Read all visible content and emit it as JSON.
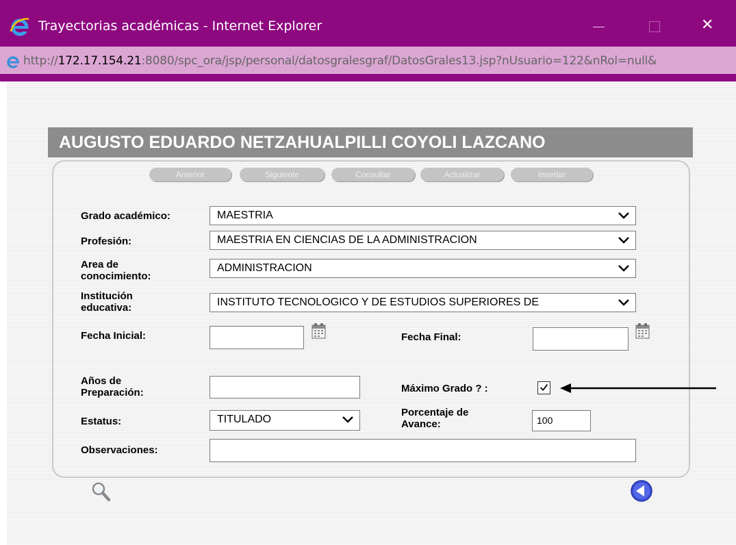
{
  "window": {
    "title": "Trayectorias académicas - Internet Explorer",
    "url_prefix": "http://",
    "url_host": "172.17.154.21",
    "url_rest": ":8080/spc_ora/jsp/personal/datosgralesgraf/DatosGrales13.jsp?nUsuario=122&nRol=null&",
    "close_glyph": "✕"
  },
  "person": {
    "name": "AUGUSTO EDUARDO NETZAHUALPILLI COYOLI LAZCANO"
  },
  "nav": {
    "anterior": "Anterior",
    "siguiente": "Siguiente",
    "consultar": "Consultar",
    "actualizar": "Actualizar",
    "insertar": "Insertar"
  },
  "form": {
    "grado_label": "Grado académico:",
    "grado_value": "MAESTRIA",
    "profesion_label": "Profesión:",
    "profesion_value": "MAESTRIA EN CIENCIAS DE LA ADMINISTRACION",
    "area_label_1": "Area de",
    "area_label_2": "conocimiento:",
    "area_value": "ADMINISTRACION",
    "inst_label_1": "Institución",
    "inst_label_2": "educativa:",
    "inst_value": "INSTITUTO TECNOLOGICO Y DE ESTUDIOS SUPERIORES DE",
    "fecha_inicial_label": "Fecha Inicial:",
    "fecha_inicial_value": "",
    "fecha_final_label": "Fecha Final:",
    "fecha_final_value": "",
    "anios_label_1": "Años de",
    "anios_label_2": "Preparación:",
    "anios_value": "",
    "maximo_label": "Máximo Grado ? :",
    "maximo_checked": true,
    "estatus_label": "Estatus:",
    "estatus_value": "TITULADO",
    "porcentaje_label_1": "Porcentaje de",
    "porcentaje_label_2": "Avance:",
    "porcentaje_value": "100",
    "observaciones_label": "Observaciones:",
    "observaciones_value": ""
  },
  "colors": {
    "titlebar": "#8e0880",
    "addressbar": "#dba6d3",
    "namebar": "#8c8c8c",
    "nav_button": "#c4c4c4",
    "back_button": "#3b4fd8"
  },
  "icons": {
    "app": "ie-icon",
    "calendar": "calendar-icon",
    "search": "magnifier-icon",
    "back": "back-arrow-icon",
    "pointer": "arrow-pointer-icon"
  }
}
